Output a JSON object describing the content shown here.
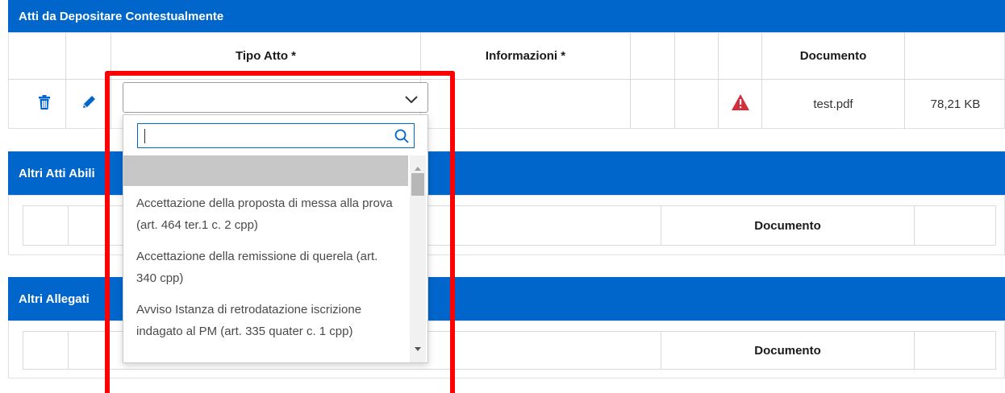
{
  "sections": {
    "atti_contestuali": {
      "title": "Atti da Depositare Contestualmente",
      "headers": {
        "tipo_atto": "Tipo Atto *",
        "informazioni": "Informazioni *",
        "documento": "Documento"
      },
      "row": {
        "tipo_atto_value": "",
        "warning_icon": "warning-triangle-icon",
        "documento": "test.pdf",
        "size": "78,21 KB"
      }
    },
    "altri_atti": {
      "title": "Altri Atti Abilitanti",
      "title_visible": "Altri Atti Abili",
      "documento": "Documento"
    },
    "altri_allegati": {
      "title": "Altri Allegati",
      "documento": "Documento"
    }
  },
  "dropdown": {
    "search_value": "",
    "options": [
      "",
      "Accettazione della proposta di messa alla prova (art. 464 ter.1 c. 2 cpp)",
      "Accettazione della remissione di querela (art. 340 cpp)",
      "Avviso Istanza di retrodatazione iscrizione indagato al PM (art. 335 quater c. 1 cpp)"
    ]
  },
  "colors": {
    "header_blue": "#0066cc",
    "highlight_red": "#ff0000",
    "warning_red": "#d32f3b"
  }
}
